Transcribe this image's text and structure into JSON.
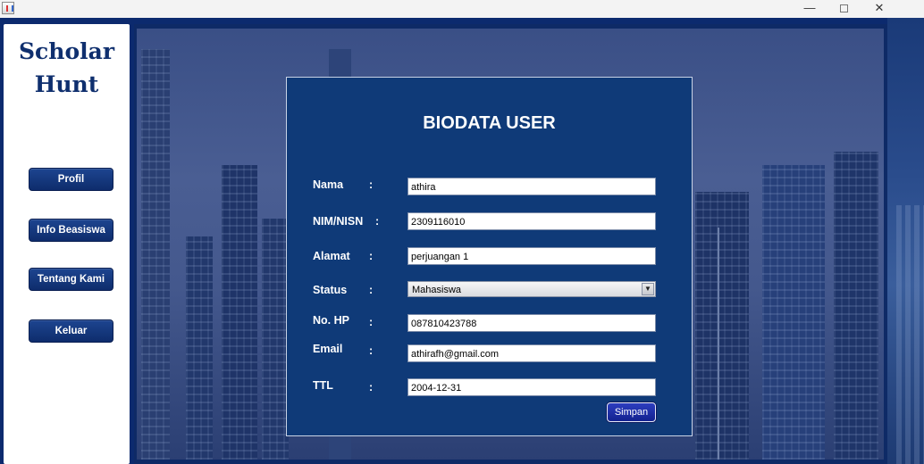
{
  "window": {
    "minimize_glyph": "—",
    "close_glyph": "✕"
  },
  "sidebar": {
    "logo_line1": "Scholar",
    "logo_line2": "Hunt",
    "items": [
      {
        "label": "Profil"
      },
      {
        "label": "Info Beasiswa"
      },
      {
        "label": "Tentang Kami"
      },
      {
        "label": "Keluar"
      }
    ]
  },
  "form": {
    "title": "BIODATA USER",
    "separator": ":",
    "fields": {
      "nama": {
        "label": "Nama",
        "value": "athira"
      },
      "nim": {
        "label": "NIM/NISN",
        "value": "2309116010"
      },
      "alamat": {
        "label": "Alamat",
        "value": "perjuangan 1"
      },
      "status": {
        "label": "Status",
        "value": "Mahasiswa"
      },
      "hp": {
        "label": "No. HP",
        "value": "087810423788"
      },
      "email": {
        "label": "Email",
        "value": "athirafh@gmail.com"
      },
      "ttl": {
        "label": "TTL",
        "value": "2004-12-31"
      }
    },
    "save_label": "Simpan"
  },
  "colors": {
    "navy": "#0f3a78",
    "sidebar_text": "#0f2f6e",
    "button": "#13228f"
  }
}
